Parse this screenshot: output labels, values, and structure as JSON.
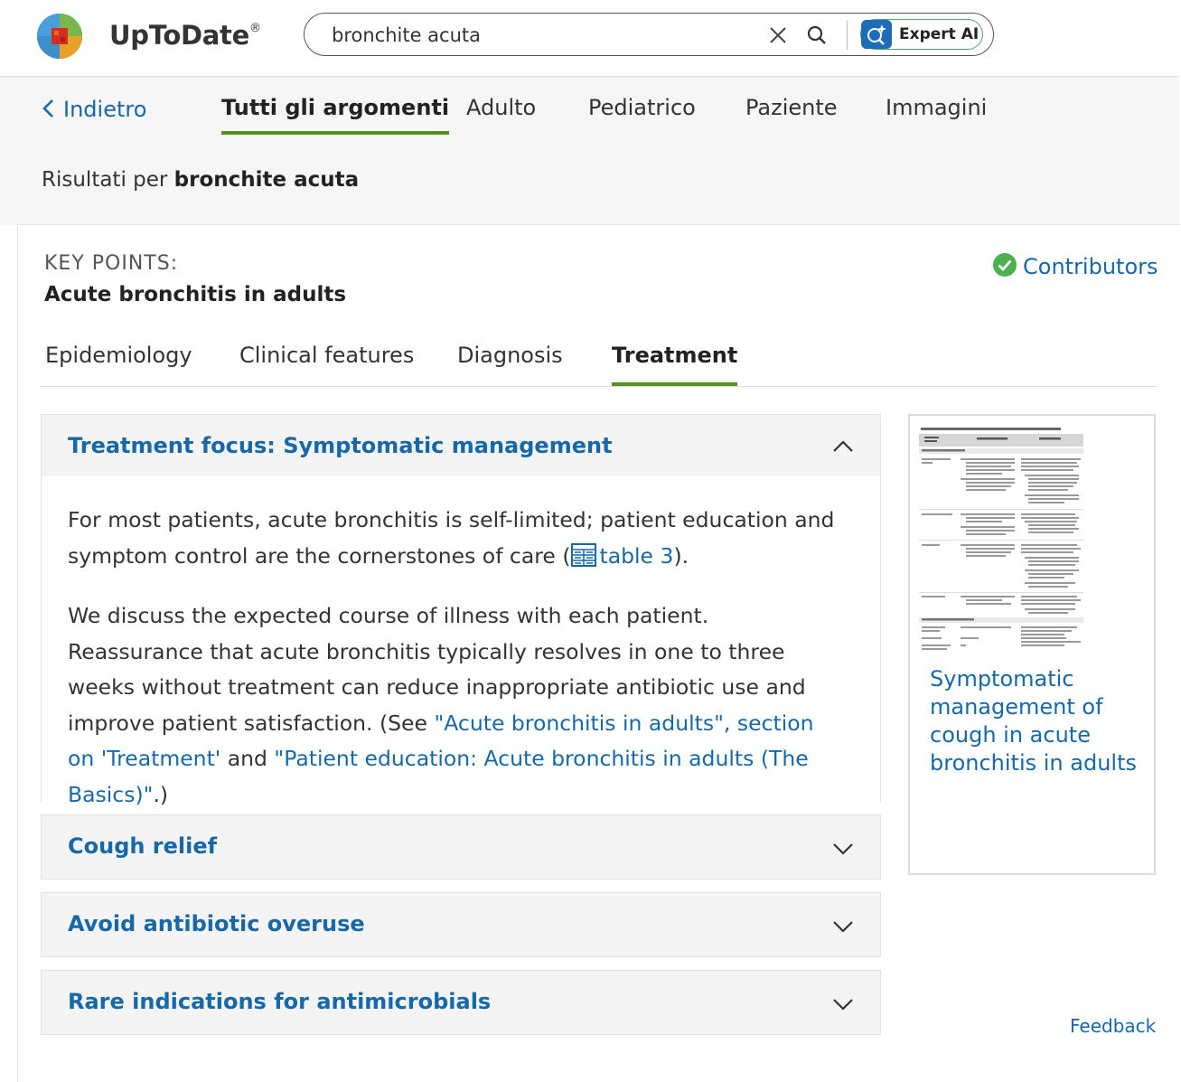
{
  "brand": {
    "name": "UpToDate",
    "reg": "®"
  },
  "search": {
    "value": "bronchite acuta",
    "expert_label": "Expert AI"
  },
  "nav": {
    "back_label": "Indietro",
    "tabs": [
      {
        "label": "Tutti gli argomenti",
        "active": true
      },
      {
        "label": "Adulto"
      },
      {
        "label": "Pediatrico"
      },
      {
        "label": "Paziente"
      },
      {
        "label": "Immagini"
      }
    ]
  },
  "results": {
    "prefix": "Risultati per ",
    "query": "bronchite acuta"
  },
  "keypoints": {
    "label": "KEY POINTS:",
    "title": "Acute bronchitis in adults",
    "contributors_label": "Contributors",
    "tabs": [
      {
        "label": "Epidemiology"
      },
      {
        "label": "Clinical features"
      },
      {
        "label": "Diagnosis"
      },
      {
        "label": "Treatment",
        "active": true
      }
    ]
  },
  "sections": [
    {
      "title": "Treatment focus: Symptomatic management",
      "expanded": true,
      "p1_text": "For most patients, acute bronchitis is self-limited; patient education and symptom control are the cornerstones of care (",
      "p1_link": "table 3",
      "p1_end": ").",
      "p2_text": "We discuss the expected course of illness with each patient. Reassurance that acute bronchitis typically resolves in one to three weeks without treatment can reduce inappropriate antibiotic use and improve patient satisfaction. (See ",
      "p2_link1": "\"Acute bronchitis in adults\", section on 'Treatment'",
      "p2_mid": " and ",
      "p2_link2": "\"Patient education: Acute bronchitis in adults (The Basics)\"",
      "p2_end": ".)"
    },
    {
      "title": "Cough relief",
      "expanded": false
    },
    {
      "title": "Avoid antibiotic overuse",
      "expanded": false
    },
    {
      "title": "Rare indications for antimicrobials",
      "expanded": false
    }
  ],
  "thumbnail": {
    "caption": "Symptomatic management of cough in acute bronchitis in adults"
  },
  "feedback_label": "Feedback",
  "colors": {
    "link": "#1668a8",
    "accent_green": "#55911f",
    "contributors_check": "#4caf50"
  }
}
